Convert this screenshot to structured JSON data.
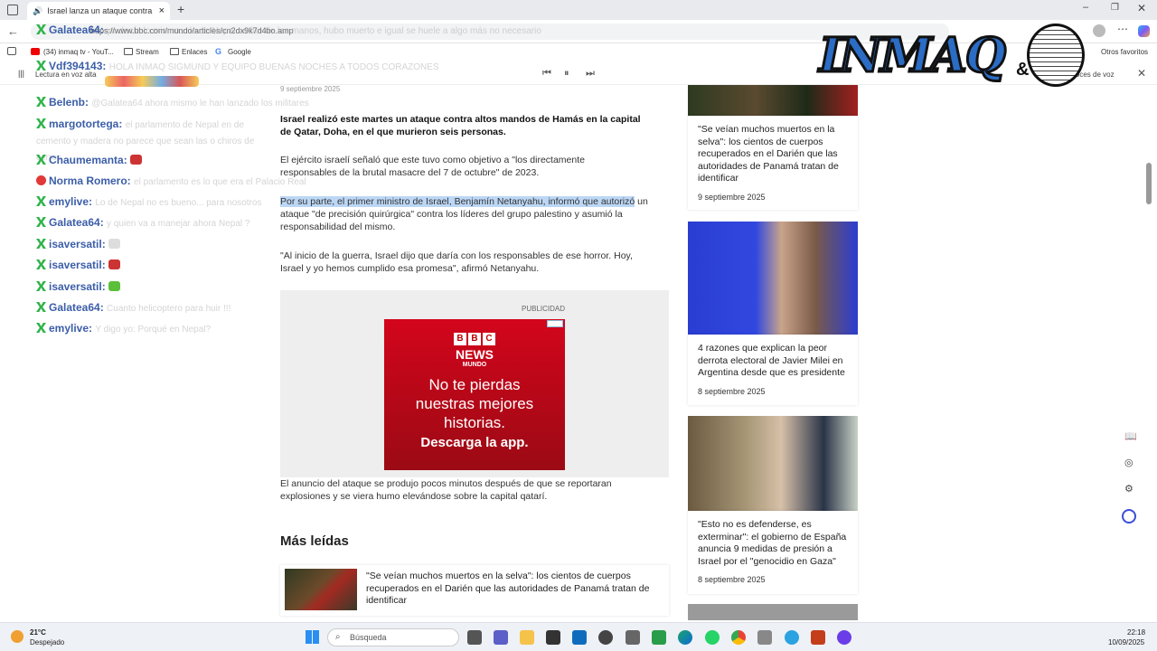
{
  "tab": {
    "title": "Israel lanza un ataque contra",
    "close": "×",
    "new": "+"
  },
  "address": {
    "url": "https://www.bbc.com/mundo/articles/cn2dx9k7d4bo.amp"
  },
  "bookmarks": [
    {
      "label": "(34) inmaq tv - YouT..."
    },
    {
      "label": "Stream"
    },
    {
      "label": "Enlaces"
    },
    {
      "label": "Google"
    }
  ],
  "bookmarks_other": "Otros favoritos",
  "reader": {
    "read_aloud": "Lectura en voz alta",
    "voices": "Voces de voz"
  },
  "logo": {
    "text": "INMAQ",
    "amp": "&"
  },
  "article": {
    "date": "9 septiembre 2025",
    "lead": "Israel realizó este martes un ataque contra altos mandos de Hamás en la capital de Qatar, Doha, en el que murieron seis personas.",
    "p1": "El ejército israelí señaló que este tuvo como objetivo a \"los directamente responsables de la brutal masacre del 7 de octubre\" de 2023.",
    "p2_highlight": "Por su parte, el primer ministro de Israel, Benjamín Netanyahu, informó que autorizó",
    "p2_rest": "un ataque \"de precisión quirúrgica\" contra los líderes del grupo palestino y asumió la responsabilidad del mismo.",
    "p3": "\"Al inicio de la guerra, Israel dijo que daría con los responsables de ese horror. Hoy, Israel y yo hemos cumplido esa promesa\", afirmó Netanyahu.",
    "ad_label": "PUBLICIDAD",
    "ad": {
      "news": "NEWS",
      "mundo": "MUNDO",
      "line1": "No te pierdas",
      "line2": "nuestras mejores",
      "line3": "historias.",
      "cta": "Descarga la app."
    },
    "p4": "El anuncio del ataque se produjo pocos minutos después de que se reportaran explosiones y se viera humo elevándose sobre la capital qatarí.",
    "mas_leidas": "Más leídas",
    "ml1": "\"Se veían muchos muertos en la selva\": los cientos de cuerpos recuperados en el Darién que las autoridades de Panamá tratan de identificar"
  },
  "sidebar": [
    {
      "title": "\"Se veían muchos muertos en la selva\": los cientos de cuerpos recuperados en el Darién que las autoridades de Panamá tratan de identificar",
      "date": "9 septiembre 2025"
    },
    {
      "title": "4 razones que explican la peor derrota electoral de Javier Milei en Argentina desde que es presidente",
      "date": "8 septiembre 2025"
    },
    {
      "title": "\"Esto no es defenderse, es exterminar\": el gobierno de España anuncia 9 medidas de presión a Israel por el \"genocidio en Gaza\"",
      "date": "8 septiembre 2025"
    }
  ],
  "chat": [
    {
      "user": "Galatea64:",
      "msg": "yo decía lo mismo... lo de Nepal se fue de las manos, hubo muerto e igual se huele a algo más no necesario"
    },
    {
      "user": "Vdf394143:",
      "msg": "HOLA INMAQ SIGMUND Y EQUIPO BUENAS NOCHES A TODOS CORAZONES"
    },
    {
      "user": "Belenb:",
      "msg": "@Galatea64 ahora mismo le han lanzado los militares"
    },
    {
      "user": "margotortega:",
      "msg": "el parlamento de Nepal en de cemento y madera no parece que sean las o chiros de cerros"
    },
    {
      "user": "Chaumemanta:",
      "msg": ""
    },
    {
      "user": "Norma Romero:",
      "msg": "el parlamento es lo que era el Palacio Real"
    },
    {
      "user": "emylive:",
      "msg": "Lo de Nepal no es bueno... para nosotros"
    },
    {
      "user": "Galatea64:",
      "msg": "y quien va a manejar ahora Nepal ?"
    },
    {
      "user": "isaversatil:",
      "msg": ""
    },
    {
      "user": "isaversatil:",
      "msg": ""
    },
    {
      "user": "isaversatil:",
      "msg": ""
    },
    {
      "user": "Galatea64:",
      "msg": "Cuanto helicoptero para huir !!!"
    },
    {
      "user": "emylive:",
      "msg": "Y digo yo: Porqué en Nepal?"
    }
  ],
  "taskbar": {
    "temp": "21°C",
    "weather": "Despejado",
    "search": "Búsqueda",
    "time": "22:18",
    "date": "10/09/2025"
  }
}
